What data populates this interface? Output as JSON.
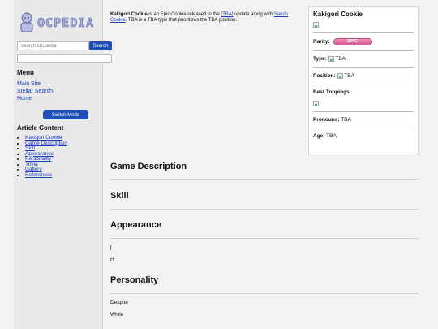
{
  "sidebar": {
    "logo_text": "OCPEDIA",
    "search_placeholder": "Search OCpedia",
    "search_button": "Search",
    "menu_heading": "Menu",
    "menu_items": [
      "Main Site",
      "Stellar Search",
      "Home"
    ],
    "switch_mode_button": "Switch Mode",
    "article_content_heading": "Article Content",
    "toc": [
      "Kakigori Cookie",
      "Game Description",
      "Skill",
      "Appearance",
      "Personality",
      "Trivia",
      "Gallery",
      "References"
    ]
  },
  "intro": {
    "name": "Kakigori Cookie",
    "text1": " is an Epic Cookie released in the ",
    "link1": "[TBA]",
    "text2": " update along with ",
    "link2": "Sando Cookie",
    "text3": ". TBA is a TBA type that prioritizes the TBA position."
  },
  "infobox": {
    "title": "Kakigori Cookie",
    "rarity_label": "Rarity:",
    "rarity_value": "EPIC",
    "type_label": "Type:",
    "type_value": "TBA",
    "position_label": "Position:",
    "position_value": "TBA",
    "toppings_label": "Best Toppings:",
    "pronouns_label": "Pronouns:",
    "pronouns_value": "TBA",
    "age_label": "Age:",
    "age_value": "TBA"
  },
  "sections": {
    "game_description": "Game Description",
    "skill": "Skill",
    "appearance": "Appearance",
    "appearance_line1": "[",
    "appearance_line2": "H",
    "personality": "Personality",
    "personality_line1": "Despite",
    "personality_line2": "While"
  }
}
